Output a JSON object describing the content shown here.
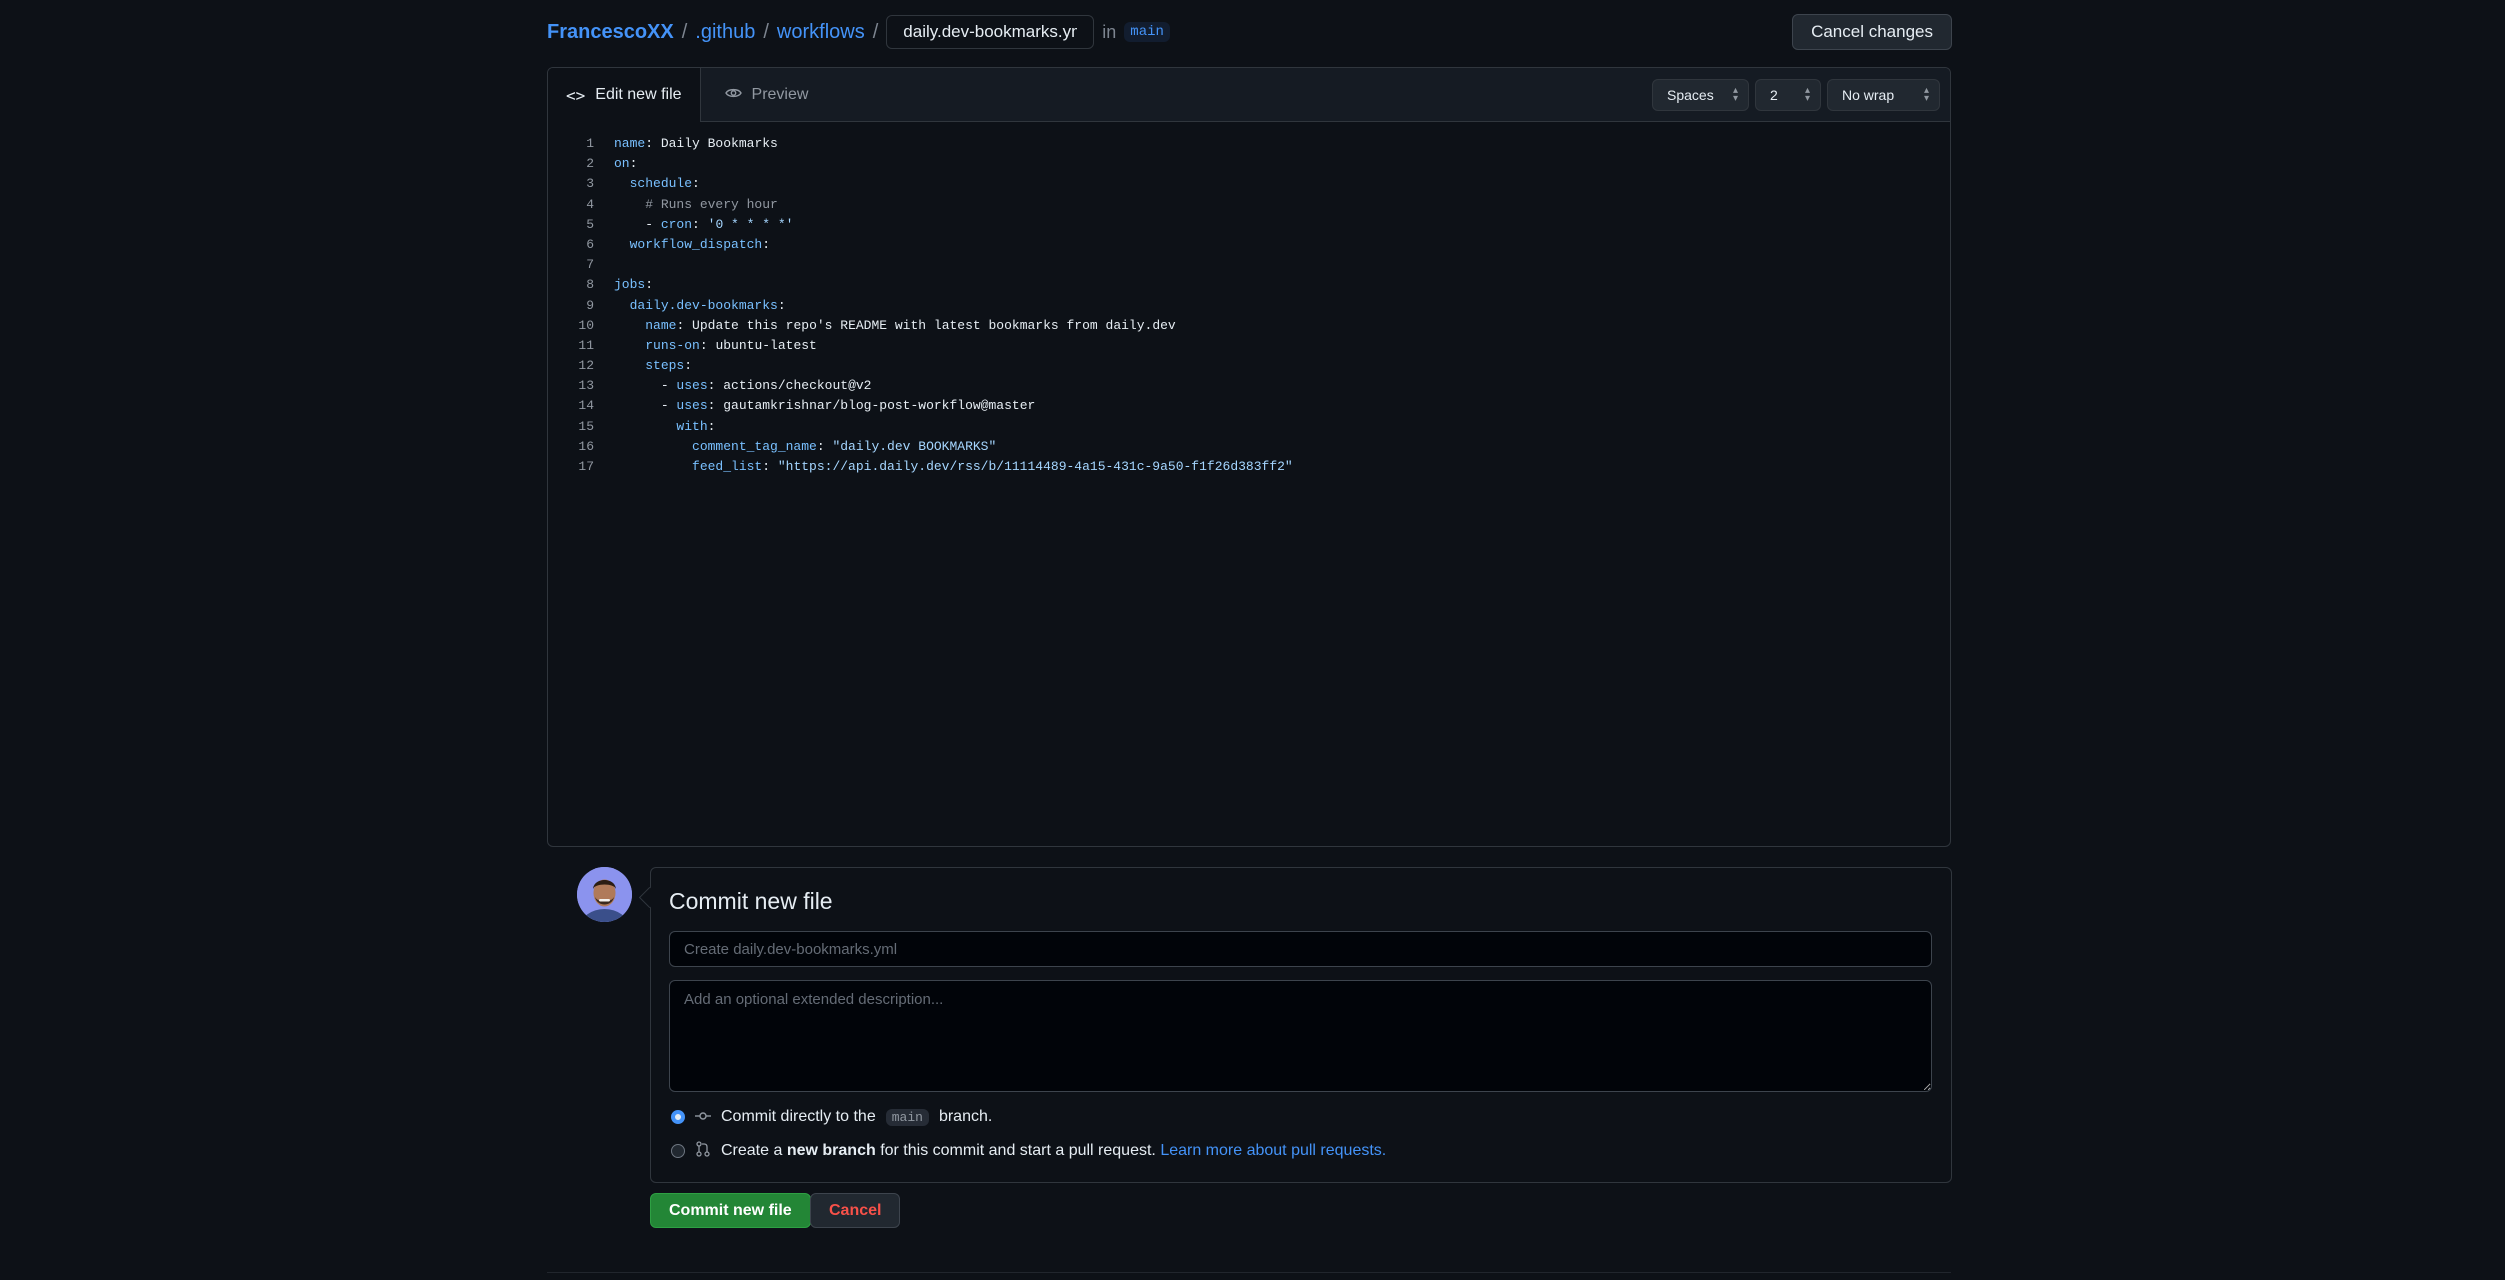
{
  "breadcrumb": {
    "owner": "FrancescoXX",
    "sep": "/",
    "dir1": ".github",
    "dir2": "workflows",
    "filename": "daily.dev-bookmarks.yml",
    "in_text": "in",
    "branch": "main"
  },
  "header": {
    "cancel_changes": "Cancel changes"
  },
  "editor": {
    "tab_edit": "Edit new file",
    "tab_edit_icon": "code-icon",
    "tab_preview": "Preview",
    "tab_preview_icon": "eye-icon",
    "indent_mode": "Spaces",
    "indent_size": "2",
    "wrap_mode": "No wrap"
  },
  "code_lines": [
    {
      "n": "1"
    },
    {
      "n": "2"
    },
    {
      "n": "3"
    },
    {
      "n": "4"
    },
    {
      "n": "5"
    },
    {
      "n": "6"
    },
    {
      "n": "7"
    },
    {
      "n": "8"
    },
    {
      "n": "9"
    },
    {
      "n": "10"
    },
    {
      "n": "11"
    },
    {
      "n": "12"
    },
    {
      "n": "13"
    },
    {
      "n": "14"
    },
    {
      "n": "15"
    },
    {
      "n": "16"
    },
    {
      "n": "17"
    }
  ],
  "code": {
    "l1k": "name",
    "l1v": "Daily Bookmarks",
    "l2k": "on",
    "l3k": "schedule",
    "l4c": "# Runs every hour",
    "l5k": "cron",
    "l5v": "'0 * * * *'",
    "l6k": "workflow_dispatch",
    "l8k": "jobs",
    "l9k": "daily.dev-bookmarks",
    "l10k": "name",
    "l10v": "Update this repo's README with latest bookmarks from daily.dev",
    "l11k": "runs-on",
    "l11v": "ubuntu-latest",
    "l12k": "steps",
    "l13k": "uses",
    "l13v": "actions/checkout@v2",
    "l14k": "uses",
    "l14v": "gautamkrishnar/blog-post-workflow@master",
    "l15k": "with",
    "l16k": "comment_tag_name",
    "l16v": "\"daily.dev BOOKMARKS\"",
    "l17k": "feed_list",
    "l17v": "\"https://api.daily.dev/rss/b/11114489-4a15-431c-9a50-f1f26d383ff2\""
  },
  "commit": {
    "title": "Commit new file",
    "summary_placeholder": "Create daily.dev-bookmarks.yml",
    "description_placeholder": "Add an optional extended description...",
    "option_direct_pre": "Commit directly to the",
    "option_direct_branch": "main",
    "option_direct_post": "branch.",
    "option_new_pre": "Create a",
    "option_new_bold": "new branch",
    "option_new_post": "for this commit and start a pull request.",
    "option_new_link": "Learn more about pull requests.",
    "submit_label": "Commit new file",
    "cancel_label": "Cancel"
  },
  "colors": {
    "background": "#0d1117",
    "accent": "#4493f8",
    "primary_button": "#238636",
    "danger_text": "#f85149"
  }
}
